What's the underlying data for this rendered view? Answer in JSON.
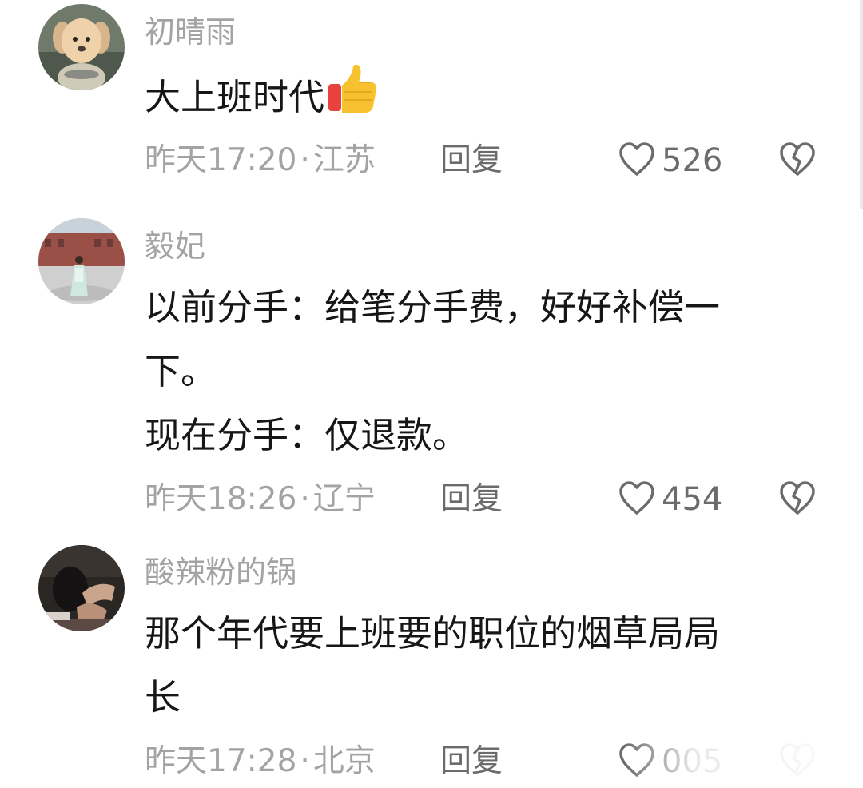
{
  "comments": [
    {
      "username": "初晴雨",
      "content_lines": [
        "大上班时代"
      ],
      "emoji": "thumbs-up-icon",
      "time": "昨天17:20",
      "dot": "·",
      "location": "江苏",
      "reply_label": "回复",
      "like_count": "526"
    },
    {
      "username": "毅妃",
      "content_lines": [
        "以前分手：给笔分手费，好好补偿一",
        "下。",
        "现在分手：仅退款。"
      ],
      "time": "昨天18:26",
      "dot": "·",
      "location": "辽宁",
      "reply_label": "回复",
      "like_count": "454"
    },
    {
      "username": "酸辣粉的锅",
      "content_lines": [
        "那个年代要上班要的职位的烟草局局",
        "长"
      ],
      "time": "昨天17:28",
      "dot": "·",
      "location": "北京",
      "reply_label": "回复",
      "like_count": "005"
    }
  ],
  "icons": {
    "like": "heart-outline-icon",
    "dislike": "broken-heart-icon"
  },
  "colors": {
    "text_primary": "#161616",
    "text_secondary": "#a3a3a3",
    "text_action": "#6b6b6b",
    "thumb_yellow": "#f7c12f",
    "thumb_red": "#e8413e"
  }
}
